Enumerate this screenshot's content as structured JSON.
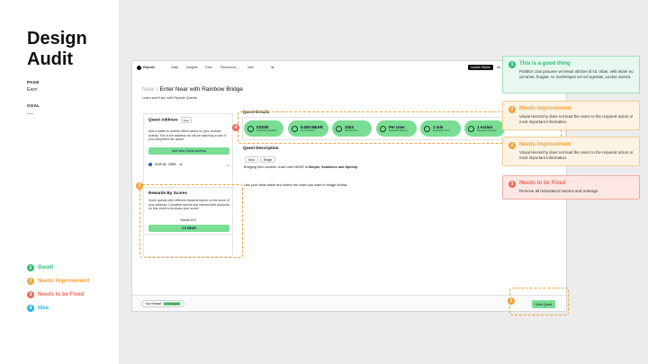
{
  "audit": {
    "title": "Design\nAudit",
    "page_label": "PAGE",
    "page_value": "Earn",
    "goal_label": "GOAL",
    "goal_value": "----"
  },
  "legend": [
    {
      "num": "1",
      "label": "Good!",
      "color": "#2fbf71"
    },
    {
      "num": "2",
      "label": "Needs Improvement",
      "color": "#f2a23a"
    },
    {
      "num": "3",
      "label": "Needs to be Fixed",
      "color": "#ef6a5b"
    },
    {
      "num": "4",
      "label": "Idea",
      "color": "#2cb5e8"
    }
  ],
  "app": {
    "logo": "Ripside",
    "nav": [
      "Daily",
      "Insights",
      "Earn",
      "Resources ⌄",
      "Intel",
      "◦",
      "⇆"
    ],
    "launch_label": "Launch Studio",
    "nav_right": "Ab",
    "breadcrumb_prev": "Near /",
    "breadcrumb_current": " Enter Near with Rainbow Bridge",
    "subtitle": "Learn and Earn with Ripside Quests"
  },
  "quest_address": {
    "title": "Quest Address",
    "tag": "Near",
    "description": "Add a wallet to access offers based on your onchain activity. This is the address we will be watching to see if you completed the action.",
    "add_button": "Add New Quest Address",
    "wallet": "0X3F1B...D59B"
  },
  "rewards": {
    "title": "Rewards By Scores",
    "description": "Some quests offer different rewards based on the score of your address. Complete quests and interact with protocols on this chain to increase your score!",
    "score_label": "Scores 0+/f",
    "value": "0.5 NEAR"
  },
  "quest_details": {
    "title": "Quest Details",
    "pills": [
      {
        "value": "0/1000",
        "label": "Rewards Available"
      },
      {
        "value": "0.000 NEAR",
        "label": "Your Reward"
      },
      {
        "value": "1024",
        "label": "Participants"
      },
      {
        "value": "Per User",
        "label": "Rewards Offered"
      },
      {
        "value": "1 min",
        "label": "Estimated Time"
      },
      {
        "value": "1 Action",
        "label": "Required Onchain"
      }
    ]
  },
  "quest_description": {
    "title": "Quest Description",
    "tags": [
      "Near",
      "Bridge"
    ],
    "line1_prefix": "Bridging from another chain onto NEAR is",
    "line1_bold": " Simple, Seamless and Speedy.",
    "line2": "Use your Near wallet and select the chain you want to bridge toNear."
  },
  "bottom": {
    "your_reward": "Your Reward",
    "reward_badge": "0.000 NEAR",
    "enter_button": "Enter Quest"
  },
  "markers": {
    "rewards": "2",
    "details": "4",
    "enter": "2"
  },
  "notes": [
    {
      "num": "1",
      "title": "This is a good thing",
      "body": "Porttitor cras posuere vel eleuit ultrices id sit. Vitae, velit etiam eu vel amet, feugiat. Ac scelerisque vel vel egestas. Lectus viverra.",
      "color": "#2fbf71",
      "bg": "#e6f8ef",
      "border": "#9fe0bc"
    },
    {
      "num": "2",
      "title": "Needs Improvement",
      "body": "Visual Hierarchy does not lead the users to the required action or most important information.",
      "color": "#f2a23a",
      "bg": "#fdf3e4",
      "border": "#f3cd93"
    },
    {
      "num": "2",
      "title": "Needs Improvement",
      "body": "Visual Hierarchy does not lead the users to the required action or most important information.",
      "color": "#f2a23a",
      "bg": "#fdf3e4",
      "border": "#f3cd93"
    },
    {
      "num": "3",
      "title": "Needs to be Fixed",
      "body": "Remove all redundanct buttons and redesign",
      "color": "#ef6a5b",
      "bg": "#fde7e5",
      "border": "#f3aaa2"
    }
  ]
}
